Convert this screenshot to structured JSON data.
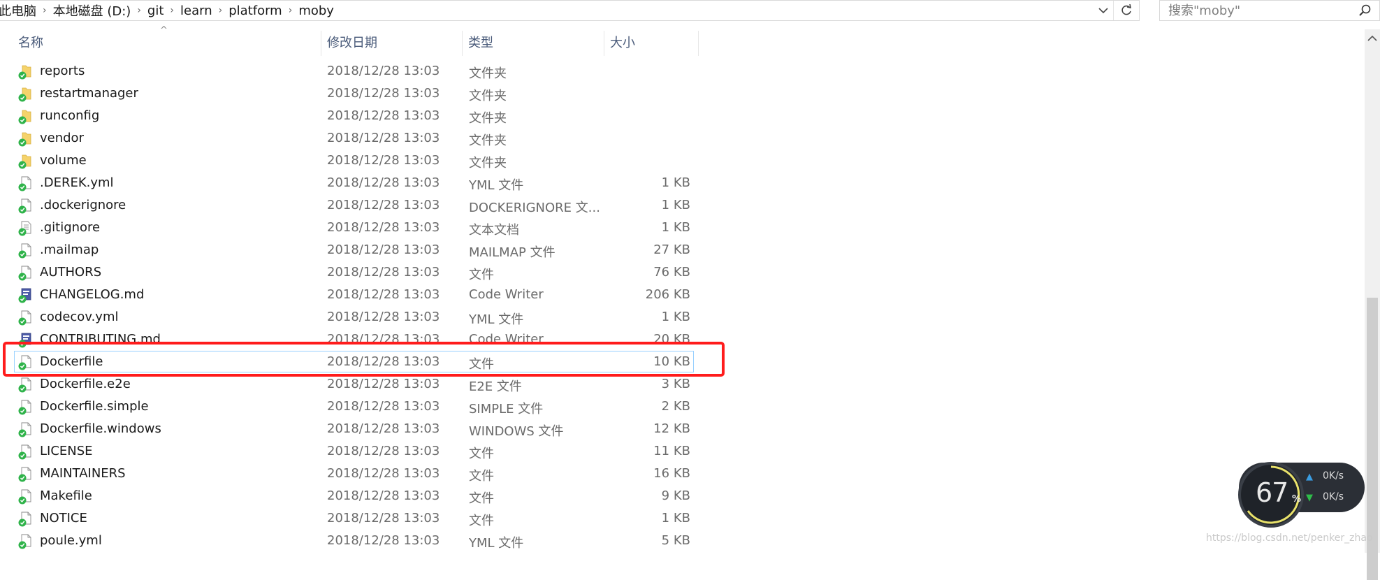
{
  "address_bar": {
    "crumbs": [
      "此电脑",
      "本地磁盘 (D:)",
      "git",
      "learn",
      "platform",
      "moby"
    ]
  },
  "search": {
    "placeholder": "搜索\"moby\""
  },
  "columns": {
    "name": "名称",
    "date": "修改日期",
    "type": "类型",
    "size": "大小"
  },
  "rows": [
    {
      "name": "reports",
      "date": "2018/12/28 13:03",
      "type": "文件夹",
      "size": "",
      "icon": "folder-icon"
    },
    {
      "name": "restartmanager",
      "date": "2018/12/28 13:03",
      "type": "文件夹",
      "size": "",
      "icon": "folder-icon"
    },
    {
      "name": "runconfig",
      "date": "2018/12/28 13:03",
      "type": "文件夹",
      "size": "",
      "icon": "folder-icon"
    },
    {
      "name": "vendor",
      "date": "2018/12/28 13:03",
      "type": "文件夹",
      "size": "",
      "icon": "folder-icon"
    },
    {
      "name": "volume",
      "date": "2018/12/28 13:03",
      "type": "文件夹",
      "size": "",
      "icon": "folder-icon"
    },
    {
      "name": ".DEREK.yml",
      "date": "2018/12/28 13:03",
      "type": "YML 文件",
      "size": "1 KB",
      "icon": "file-icon"
    },
    {
      "name": ".dockerignore",
      "date": "2018/12/28 13:03",
      "type": "DOCKERIGNORE 文...",
      "size": "1 KB",
      "icon": "file-icon"
    },
    {
      "name": ".gitignore",
      "date": "2018/12/28 13:03",
      "type": "文本文档",
      "size": "1 KB",
      "icon": "text-file-icon"
    },
    {
      "name": ".mailmap",
      "date": "2018/12/28 13:03",
      "type": "MAILMAP 文件",
      "size": "27 KB",
      "icon": "file-icon"
    },
    {
      "name": "AUTHORS",
      "date": "2018/12/28 13:03",
      "type": "文件",
      "size": "76 KB",
      "icon": "file-icon"
    },
    {
      "name": "CHANGELOG.md",
      "date": "2018/12/28 13:03",
      "type": "Code Writer",
      "size": "206 KB",
      "icon": "code-file-icon"
    },
    {
      "name": "codecov.yml",
      "date": "2018/12/28 13:03",
      "type": "YML 文件",
      "size": "1 KB",
      "icon": "file-icon"
    },
    {
      "name": "CONTRIBUTING.md",
      "date": "2018/12/28 13:03",
      "type": "Code Writer",
      "size": "20 KB",
      "icon": "code-file-icon"
    },
    {
      "name": "Dockerfile",
      "date": "2018/12/28 13:03",
      "type": "文件",
      "size": "10 KB",
      "icon": "file-icon",
      "selected": true
    },
    {
      "name": "Dockerfile.e2e",
      "date": "2018/12/28 13:03",
      "type": "E2E 文件",
      "size": "3 KB",
      "icon": "file-icon"
    },
    {
      "name": "Dockerfile.simple",
      "date": "2018/12/28 13:03",
      "type": "SIMPLE 文件",
      "size": "2 KB",
      "icon": "file-icon"
    },
    {
      "name": "Dockerfile.windows",
      "date": "2018/12/28 13:03",
      "type": "WINDOWS 文件",
      "size": "12 KB",
      "icon": "file-icon"
    },
    {
      "name": "LICENSE",
      "date": "2018/12/28 13:03",
      "type": "文件",
      "size": "11 KB",
      "icon": "file-icon"
    },
    {
      "name": "MAINTAINERS",
      "date": "2018/12/28 13:03",
      "type": "文件",
      "size": "16 KB",
      "icon": "file-icon"
    },
    {
      "name": "Makefile",
      "date": "2018/12/28 13:03",
      "type": "文件",
      "size": "9 KB",
      "icon": "file-icon"
    },
    {
      "name": "NOTICE",
      "date": "2018/12/28 13:03",
      "type": "文件",
      "size": "1 KB",
      "icon": "file-icon"
    },
    {
      "name": "poule.yml",
      "date": "2018/12/28 13:03",
      "type": "YML 文件",
      "size": "5 KB",
      "icon": "file-icon"
    }
  ],
  "network_widget": {
    "percent": "67",
    "percent_sign": "%",
    "upload": "0K/s",
    "download": "0K/s"
  },
  "watermark": "https://blog.csdn.net/penker_zhao",
  "colors": {
    "accent_blue": "#99d1ff",
    "highlight_red": "#ff1c1c",
    "sync_green": "#2fb34a"
  }
}
